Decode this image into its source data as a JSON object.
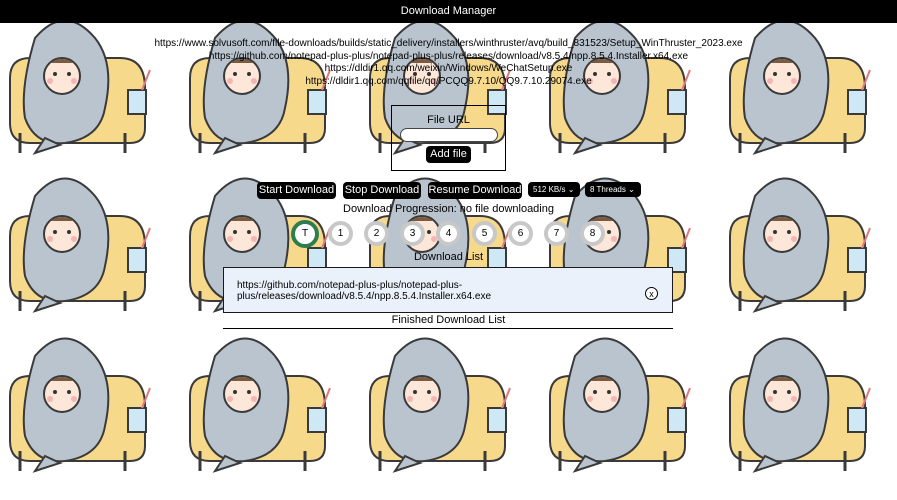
{
  "window": {
    "title": "Download Manager"
  },
  "queued_urls": [
    "https://www.solvusoft.com/file-downloads/builds/static_delivery/installers/winthruster/avq/build_831523/Setup_WinThruster_2023.exe",
    "https://github.com/notepad-plus-plus/notepad-plus-plus/releases/download/v8.5.4/npp.8.5.4.Installer.x64.exe",
    "https://dldir1.qq.com/weixin/Windows/WeChatSetup.exe",
    "https://dldir1.qq.com/qqfile/qq/PCQQ9.7.10/QQ9.7.10.29074.exe"
  ],
  "file_url": {
    "label": "File URL",
    "value": "",
    "add_label": "Add file"
  },
  "controls": {
    "start": "Start Download",
    "stop": "Stop Download",
    "resume": "Resume Download",
    "speed": "512 KB/s",
    "threads": "8 Threads"
  },
  "progress_text": "Download Progression: no file downloading",
  "thread_indicators": [
    "T",
    "1",
    "2",
    "3",
    "4",
    "5",
    "6",
    "7",
    "8"
  ],
  "download_list": {
    "title": "Download List",
    "items": [
      {
        "url": "https://github.com/notepad-plus-plus/notepad-plus-plus/releases/download/v8.5.4/npp.8.5.4.Installer.x64.exe",
        "remove": "x"
      }
    ]
  },
  "finished_list": {
    "title": "Finished Download List"
  },
  "colors": {
    "titlebar": "#000000",
    "active_thread": "#2e7d4f",
    "inactive_thread": "#c8c8c8",
    "list_bg": "#eaf1fb"
  },
  "icons": {
    "dropdown": "chevron-down-icon",
    "remove": "close-circle-icon"
  }
}
